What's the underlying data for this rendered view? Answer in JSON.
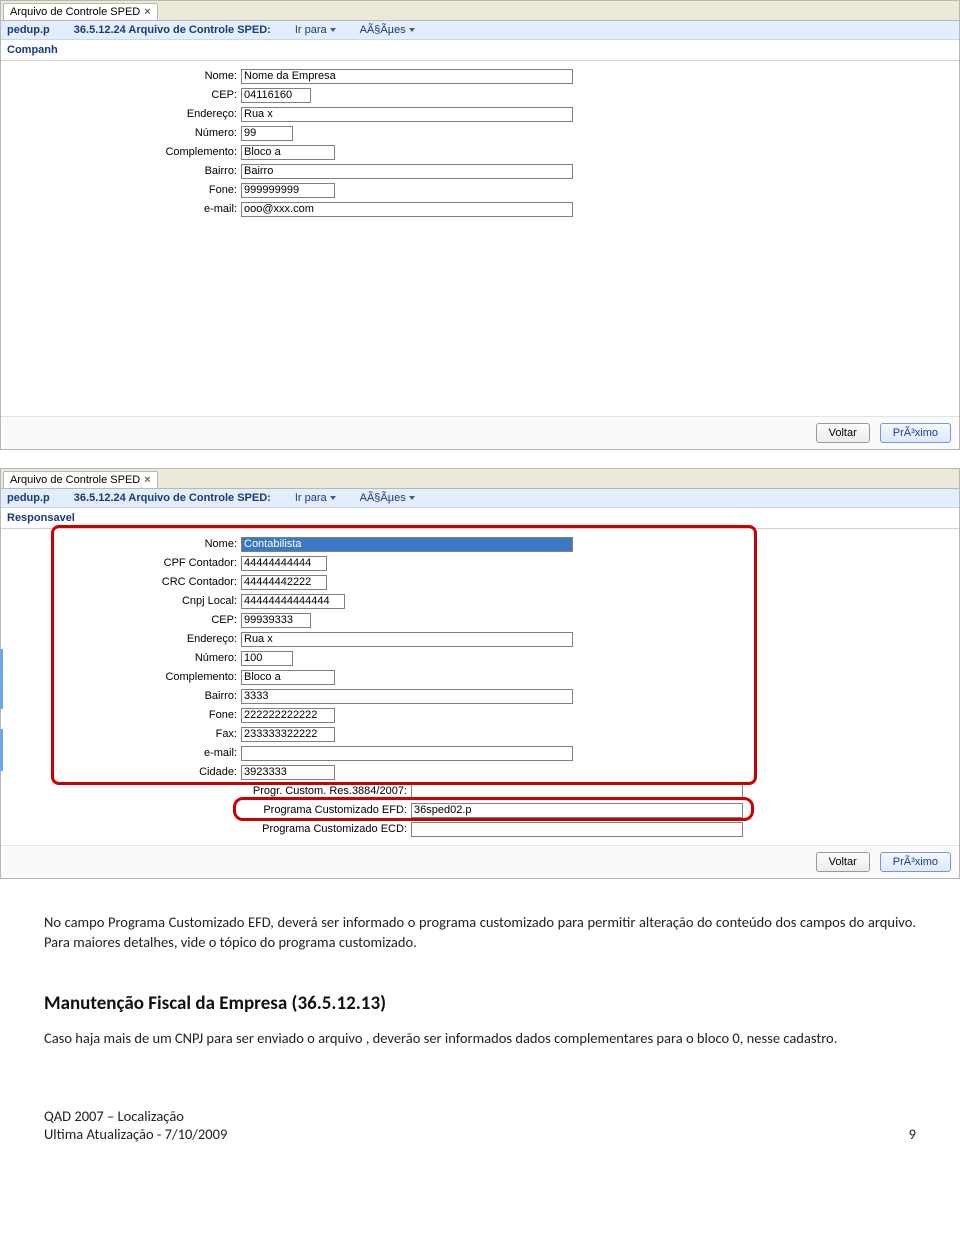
{
  "window1": {
    "tab_label": "Arquivo de Controle SPED",
    "program": "pedup.p",
    "title": "36.5.12.24 Arquivo de Controle SPED:",
    "goto_label": "Ir para",
    "actions_label": "AÃ§Ãµes",
    "section": "Companh",
    "fields": {
      "nome_label": "Nome:",
      "nome_value": "Nome da Empresa",
      "cep_label": "CEP:",
      "cep_value": "04116160",
      "end_label": "Endereço:",
      "end_value": "Rua x",
      "num_label": "Número:",
      "num_value": "99",
      "comp_label": "Complemento:",
      "comp_value": "Bloco a",
      "bairro_label": "Bairro:",
      "bairro_value": "Bairro",
      "fone_label": "Fone:",
      "fone_value": "999999999",
      "email_label": "e-mail:",
      "email_value": "ooo@xxx.com"
    },
    "back_btn": "Voltar",
    "next_btn": "PrÃ³ximo"
  },
  "window2": {
    "tab_label": "Arquivo de Controle SPED",
    "program": "pedup.p",
    "title": "36.5.12.24 Arquivo de Controle SPED:",
    "goto_label": "Ir para",
    "actions_label": "AÃ§Ãµes",
    "section": "Responsavel",
    "fields": {
      "nome_label": "Nome:",
      "nome_value": "Contabilista",
      "cpf_label": "CPF Contador:",
      "cpf_value": "44444444444",
      "crc_label": "CRC Contador:",
      "crc_value": "44444442222",
      "cnpj_label": "Cnpj Local:",
      "cnpj_value": "44444444444444",
      "cep_label": "CEP:",
      "cep_value": "99939333",
      "end_label": "Endereço:",
      "end_value": "Rua x",
      "num_label": "Número:",
      "num_value": "100",
      "comp_label": "Complemento:",
      "comp_value": "Bloco a",
      "bairro_label": "Bairro:",
      "bairro_value": "3333",
      "fone_label": "Fone:",
      "fone_value": "222222222222",
      "fax_label": "Fax:",
      "fax_value": "233333322222",
      "email_label": "e-mail:",
      "email_value": "",
      "cidade_label": "Cidade:",
      "cidade_value": "3923333",
      "progr_label": "Progr. Custom. Res.3884/2007:",
      "progr_value": "",
      "efd_label": "Programa Customizado EFD:",
      "efd_value": "36sped02.p",
      "ecd_label": "Programa Customizado ECD:",
      "ecd_value": ""
    },
    "back_btn": "Voltar",
    "next_btn": "PrÃ³ximo"
  },
  "doc": {
    "p1": "No campo Programa Customizado EFD, deverá ser informado o programa customizado para permitir alteração do conteúdo dos campos do arquivo. Para maiores detalhes, vide o tópico do programa customizado.",
    "h2": "Manutenção Fiscal da Empresa (36.5.12.13)",
    "p2": "Caso haja mais de um CNPJ para ser enviado o arquivo , deverão ser informados dados complementares para o bloco 0, nesse cadastro.",
    "footer_left1": "QAD 2007 – Localização",
    "footer_left2": "Ultima Atualização - 7/10/2009",
    "footer_right": "9"
  }
}
